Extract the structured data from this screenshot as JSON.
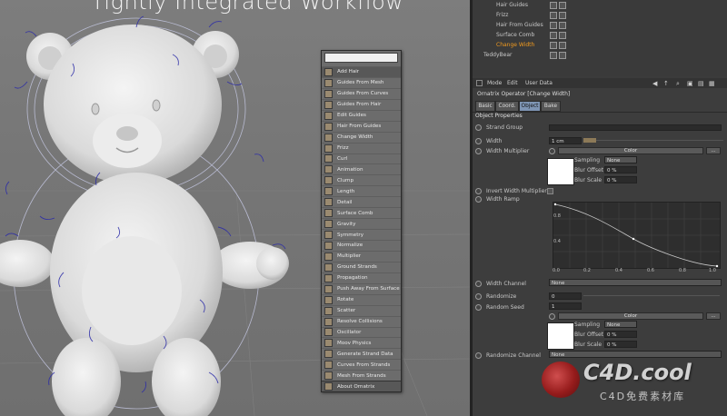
{
  "headline": "Tightly Integrated Workflow",
  "menu": {
    "search_value": "",
    "items": [
      "Add Hair",
      "Guides From Mesh",
      "Guides From Curves",
      "Guides From Hair",
      "Edit Guides",
      "Hair From Guides",
      "Change Width",
      "Frizz",
      "Curl",
      "Animation",
      "Clump",
      "Length",
      "Detail",
      "Surface Comb",
      "Gravity",
      "Symmetry",
      "Normalize",
      "Multiplier",
      "Ground Strands",
      "Propagation",
      "Push Away From Surface",
      "Rotate",
      "Scatter",
      "Resolve Collisions",
      "Oscillator",
      "Moov Physics",
      "Generate Strand Data",
      "Curves From Strands",
      "Mesh From Strands",
      "About Ornatrix"
    ]
  },
  "object_manager": {
    "items": [
      {
        "name": "Hair Guides",
        "highlight": false
      },
      {
        "name": "Frizz",
        "highlight": false
      },
      {
        "name": "Hair From Guides",
        "highlight": false
      },
      {
        "name": "Surface Comb",
        "highlight": false
      },
      {
        "name": "Change Width",
        "highlight": true
      },
      {
        "name": "TeddyBear",
        "highlight": false
      }
    ]
  },
  "attributes": {
    "menu": [
      "Mode",
      "Edit",
      "User Data"
    ],
    "operator_title": "Ornatrix Operator [Change Width]",
    "tabs": [
      "Basic",
      "Coord.",
      "Object",
      "Bake"
    ],
    "active_tab": "Object",
    "section_title": "Object Properties",
    "strand_group_label": "Strand Group",
    "width_label": "Width",
    "width_value": "1 cm",
    "width_multiplier_label": "Width Multiplier",
    "color_button": "Color",
    "sampling_label": "Sampling",
    "sampling_value": "None",
    "blur_offset_label": "Blur Offset",
    "blur_offset_value": "0 %",
    "blur_scale_label": "Blur Scale",
    "blur_scale_value": "0 %",
    "invert_label": "Invert Width Multiplier",
    "width_ramp_label": "Width Ramp",
    "graph_y_ticks": [
      "0.8",
      "0.4"
    ],
    "graph_x_ticks": [
      "0.0",
      "0.2",
      "0.4",
      "0.6",
      "0.8",
      "1.0"
    ],
    "width_channel_label": "Width Channel",
    "width_channel_value": "None",
    "randomize_label": "Randomize",
    "randomize_value": "0",
    "random_seed_label": "Random Seed",
    "random_seed_value": "1",
    "color_button_2": "Color",
    "sampling_value_2": "None",
    "blur_offset_value_2": "0 %",
    "blur_scale_value_2": "0 %",
    "randomize_channel_label": "Randomize Channel",
    "randomize_channel_value": "None"
  },
  "watermark": {
    "big": "C4D.cool",
    "small": "C4D免费素材库"
  },
  "colors": {
    "accent": "#f29b1f",
    "tab_active": "#7e95b4",
    "hair": "#2c2ca8"
  }
}
